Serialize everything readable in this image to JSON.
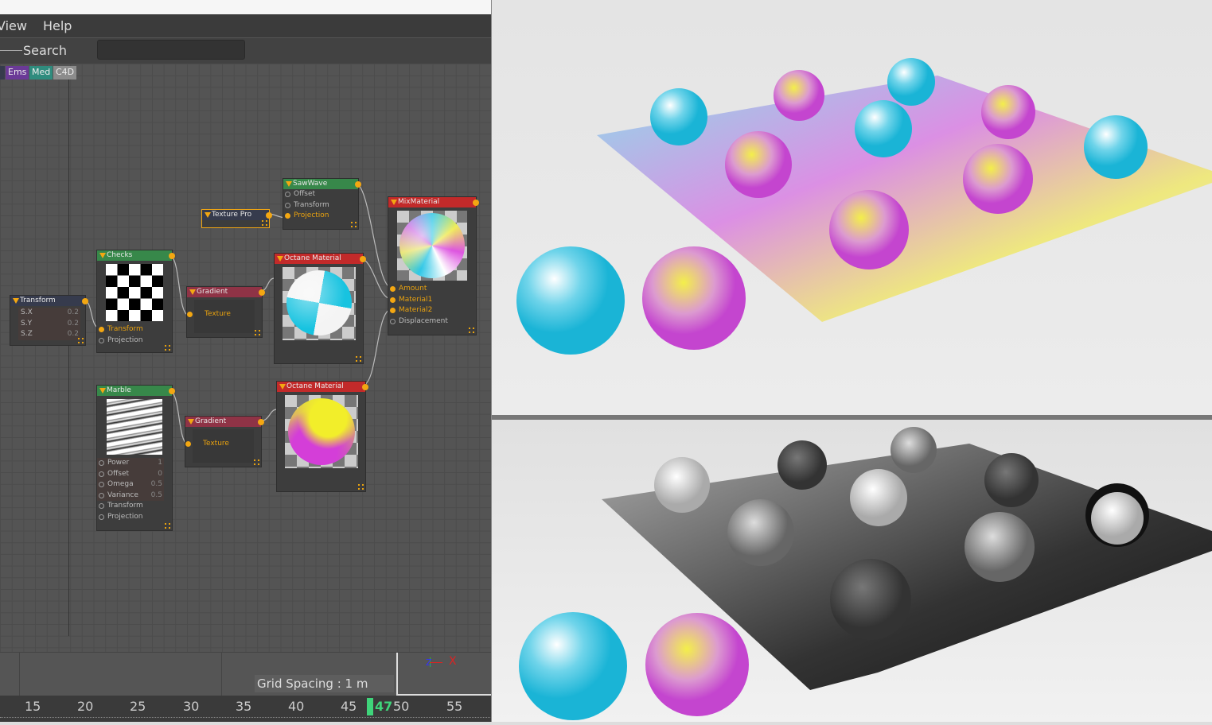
{
  "menu": {
    "items": [
      "View",
      "Help"
    ]
  },
  "search": {
    "label": "Search",
    "value": ""
  },
  "tags": [
    {
      "label": "Ems",
      "color": "#6b3a97"
    },
    {
      "label": "Med",
      "color": "#2f8c7e"
    },
    {
      "label": "C4D",
      "color": "#8c8c8c"
    }
  ],
  "nodes": {
    "transform": {
      "title": "Transform",
      "params": [
        {
          "name": "S.X",
          "value": "0.2"
        },
        {
          "name": "S.Y",
          "value": "0.2"
        },
        {
          "name": "S.Z",
          "value": "0.2"
        }
      ]
    },
    "checks": {
      "title": "Checks",
      "inputs": [
        "Transform",
        "Projection"
      ]
    },
    "texture_pro": {
      "title": "Texture Pro"
    },
    "sawwave": {
      "title": "SawWave",
      "inputs": [
        "Offset",
        "Transform",
        "Projection"
      ]
    },
    "gradient1": {
      "title": "Gradient",
      "inputs": [
        "Texture"
      ]
    },
    "octane1": {
      "title": "Octane Material"
    },
    "mix": {
      "title": "MixMaterial",
      "inputs": [
        "Amount",
        "Material1",
        "Material2",
        "Displacement"
      ]
    },
    "marble": {
      "title": "Marble",
      "params": [
        {
          "name": "Power",
          "value": "1"
        },
        {
          "name": "Offset",
          "value": "0"
        },
        {
          "name": "Omega",
          "value": "0.5"
        },
        {
          "name": "Variance",
          "value": "0.5"
        },
        {
          "name": "Transform",
          "value": ""
        },
        {
          "name": "Projection",
          "value": ""
        }
      ]
    },
    "gradient2": {
      "title": "Gradient",
      "inputs": [
        "Texture"
      ]
    },
    "octane2": {
      "title": "Octane Material"
    }
  },
  "viewport": {
    "grid_spacing": "Grid Spacing : 1 m",
    "axis_z": "Z",
    "axis_x": "X"
  },
  "timeline": {
    "ticks": [
      "15",
      "20",
      "25",
      "30",
      "35",
      "40",
      "45",
      "50",
      "55"
    ],
    "current_frame": "47"
  },
  "colors": {
    "accent": "#f3a712",
    "playhead": "#3fd47a"
  }
}
